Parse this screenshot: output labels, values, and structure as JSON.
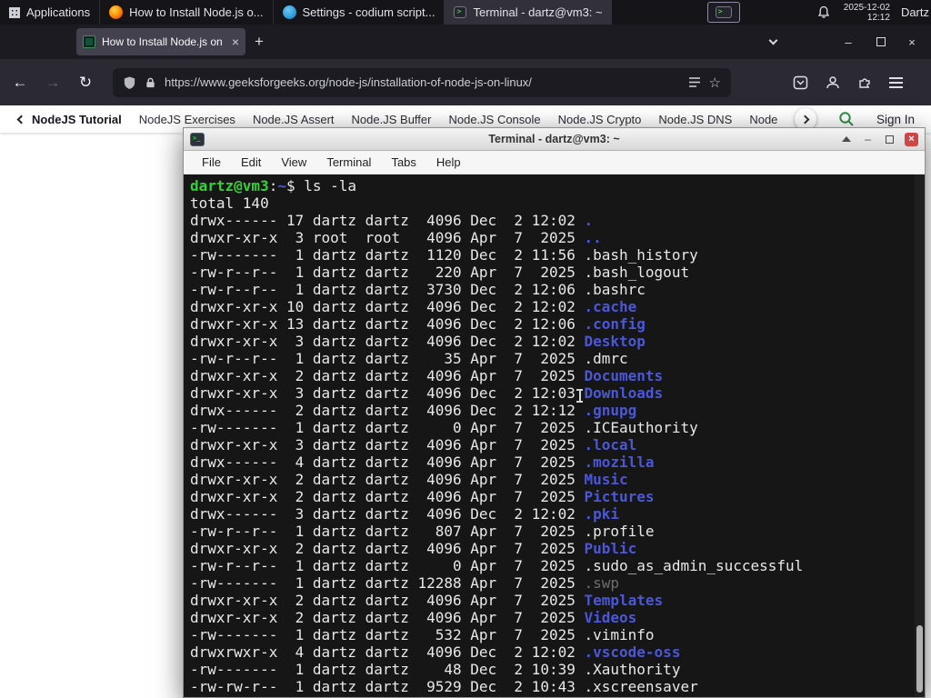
{
  "panel": {
    "applications_label": "Applications",
    "tasks": [
      {
        "label": "How to Install Node.js o...",
        "icon": "firefox"
      },
      {
        "label": "Settings - codium script...",
        "icon": "codium"
      },
      {
        "label": "Terminal - dartz@vm3: ~",
        "icon": "terminal"
      }
    ],
    "clock_date": "2025-12-02",
    "clock_time": "12:12",
    "user": "Dartz"
  },
  "icons": {
    "plus": "+",
    "close": "×",
    "minimize": "–",
    "back": "←",
    "forward": "→",
    "reload": "↻",
    "star": "☆"
  },
  "browser": {
    "tab_title": "How to Install Node.js on",
    "url": "https://www.geeksforgeeks.org/node-js/installation-of-node-js-on-linux/",
    "page_nav": {
      "primary": "NodeJS Tutorial",
      "links": [
        "NodeJS Exercises",
        "Node.JS Assert",
        "Node.JS Buffer",
        "Node.JS Console",
        "Node.JS Crypto",
        "Node.JS DNS",
        "Node"
      ],
      "sign_in": "Sign In"
    }
  },
  "terminal": {
    "title": "Terminal - dartz@vm3: ~",
    "menu": [
      "File",
      "Edit",
      "View",
      "Terminal",
      "Tabs",
      "Help"
    ],
    "prompt": {
      "user_host": "dartz@vm3",
      "colon": ":",
      "path": "~",
      "symbol": "$ ",
      "command": "ls -la"
    },
    "total_line": "total 140",
    "listing": [
      {
        "meta": "drwx------ 17 dartz dartz  4096 Dec  2 12:02 ",
        "name": ".",
        "kind": "dir"
      },
      {
        "meta": "drwxr-xr-x  3 root  root   4096 Apr  7  2025 ",
        "name": "..",
        "kind": "dir"
      },
      {
        "meta": "-rw-------  1 dartz dartz  1120 Dec  2 11:56 ",
        "name": ".bash_history",
        "kind": "file"
      },
      {
        "meta": "-rw-r--r--  1 dartz dartz   220 Apr  7  2025 ",
        "name": ".bash_logout",
        "kind": "file"
      },
      {
        "meta": "-rw-r--r--  1 dartz dartz  3730 Dec  2 12:06 ",
        "name": ".bashrc",
        "kind": "file"
      },
      {
        "meta": "drwxr-xr-x 10 dartz dartz  4096 Dec  2 12:02 ",
        "name": ".cache",
        "kind": "dir"
      },
      {
        "meta": "drwxr-xr-x 13 dartz dartz  4096 Dec  2 12:06 ",
        "name": ".config",
        "kind": "dir"
      },
      {
        "meta": "drwxr-xr-x  3 dartz dartz  4096 Dec  2 12:02 ",
        "name": "Desktop",
        "kind": "dir"
      },
      {
        "meta": "-rw-r--r--  1 dartz dartz    35 Apr  7  2025 ",
        "name": ".dmrc",
        "kind": "file"
      },
      {
        "meta": "drwxr-xr-x  2 dartz dartz  4096 Apr  7  2025 ",
        "name": "Documents",
        "kind": "dir"
      },
      {
        "meta": "drwxr-xr-x  3 dartz dartz  4096 Dec  2 12:03 ",
        "name": "Downloads",
        "kind": "dir"
      },
      {
        "meta": "drwx------  2 dartz dartz  4096 Dec  2 12:12 ",
        "name": ".gnupg",
        "kind": "dir"
      },
      {
        "meta": "-rw-------  1 dartz dartz     0 Apr  7  2025 ",
        "name": ".ICEauthority",
        "kind": "file"
      },
      {
        "meta": "drwxr-xr-x  3 dartz dartz  4096 Apr  7  2025 ",
        "name": ".local",
        "kind": "dir"
      },
      {
        "meta": "drwx------  4 dartz dartz  4096 Apr  7  2025 ",
        "name": ".mozilla",
        "kind": "dir"
      },
      {
        "meta": "drwxr-xr-x  2 dartz dartz  4096 Apr  7  2025 ",
        "name": "Music",
        "kind": "dir"
      },
      {
        "meta": "drwxr-xr-x  2 dartz dartz  4096 Apr  7  2025 ",
        "name": "Pictures",
        "kind": "dir"
      },
      {
        "meta": "drwx------  3 dartz dartz  4096 Dec  2 12:02 ",
        "name": ".pki",
        "kind": "dir"
      },
      {
        "meta": "-rw-r--r--  1 dartz dartz   807 Apr  7  2025 ",
        "name": ".profile",
        "kind": "file"
      },
      {
        "meta": "drwxr-xr-x  2 dartz dartz  4096 Apr  7  2025 ",
        "name": "Public",
        "kind": "dir"
      },
      {
        "meta": "-rw-r--r--  1 dartz dartz     0 Apr  7  2025 ",
        "name": ".sudo_as_admin_successful",
        "kind": "file"
      },
      {
        "meta": "-rw-------  1 dartz dartz 12288 Apr  7  2025 ",
        "name": ".swp",
        "kind": "dim"
      },
      {
        "meta": "drwxr-xr-x  2 dartz dartz  4096 Apr  7  2025 ",
        "name": "Templates",
        "kind": "dir"
      },
      {
        "meta": "drwxr-xr-x  2 dartz dartz  4096 Apr  7  2025 ",
        "name": "Videos",
        "kind": "dir"
      },
      {
        "meta": "-rw-------  1 dartz dartz   532 Apr  7  2025 ",
        "name": ".viminfo",
        "kind": "file"
      },
      {
        "meta": "drwxrwxr-x  4 dartz dartz  4096 Dec  2 12:02 ",
        "name": ".vscode-oss",
        "kind": "dir"
      },
      {
        "meta": "-rw-------  1 dartz dartz    48 Dec  2 10:39 ",
        "name": ".Xauthority",
        "kind": "file"
      },
      {
        "meta": "-rw-rw-r--  1 dartz dartz  9529 Dec  2 10:43 ",
        "name": ".xscreensaver",
        "kind": "file"
      }
    ]
  },
  "colors": {
    "accent_green": "#2f8d46",
    "terminal_green": "#30d430",
    "terminal_blue": "#4b57d8",
    "terminal_bg": "#161616",
    "panel_bg": "#151419",
    "toolbar_bg": "#2b2a33"
  }
}
